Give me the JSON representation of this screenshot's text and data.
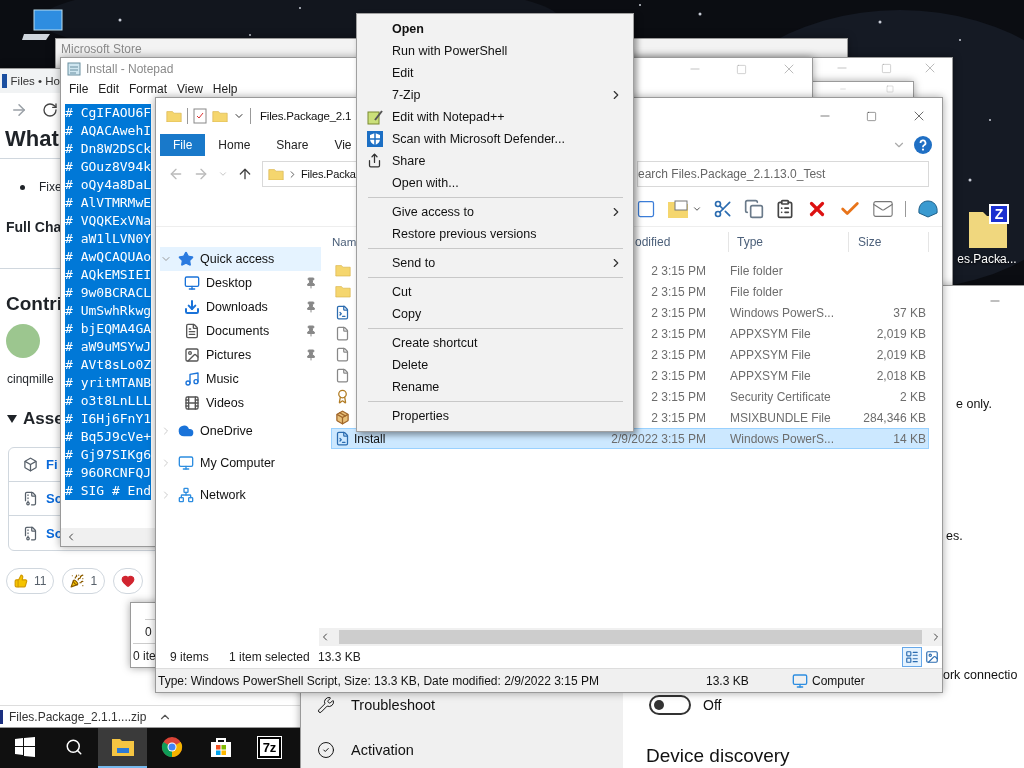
{
  "desktop": {
    "icons": [
      {
        "kind": "computer"
      },
      {
        "kind": "archive",
        "badge": "Z",
        "label": "es.Packa..."
      }
    ]
  },
  "store_window": {
    "title": "Microsoft Store"
  },
  "browser": {
    "tab": "Files • Ho",
    "heading": "What",
    "bullet": "Fixe",
    "subheading": "Full Cha",
    "contributors_heading": "Contri",
    "contributor": "cinqmille",
    "assets_heading": "Asse",
    "assets_expanded": true,
    "assets": [
      {
        "kind": "package",
        "label": "Fi"
      },
      {
        "kind": "zip",
        "label": "So"
      },
      {
        "kind": "zip",
        "label": "So"
      }
    ],
    "reactions": [
      {
        "kind": "thumbs-up",
        "count": "11"
      },
      {
        "kind": "party",
        "count": "1"
      },
      {
        "kind": "heart"
      }
    ],
    "download": {
      "file": "Files.Package_2.1.1....zip"
    }
  },
  "settings": {
    "items": [
      {
        "kind": "troubleshoot",
        "label": "Troubleshoot"
      },
      {
        "kind": "activation",
        "label": "Activation"
      }
    ],
    "fragments": [
      "e only.",
      "es.",
      "ork connectio"
    ],
    "toggle": {
      "on": false,
      "label": "Off"
    },
    "section": "Device discovery"
  },
  "small_window": {
    "lines": [
      "0",
      "0 ite"
    ]
  },
  "notepad": {
    "title": "Install - Notepad",
    "menu": [
      "File",
      "Edit",
      "Format",
      "View",
      "Help"
    ],
    "text_selected": true,
    "lines": [
      "# CgIFAOU6F",
      "# AQACAwehI",
      "# Dn8W2DSCk",
      "# GOuz8V94k",
      "# oQy4a8DaL",
      "# AlVTMRMwE",
      "# VQQKExVNa",
      "# aW1lLVN0Y",
      "# AwQCAQUAo",
      "# AQkEMSIEI",
      "# 9w0BCRACL",
      "# UmSwhRkwg",
      "# bjEQMA4GA",
      "# aW9uMSYwJ",
      "# AVt8sLo0Z",
      "# yritMTANB",
      "# o3t8LnLLL",
      "# I6Hj6FnY1",
      "# Bq5J9cVe+",
      "# Gj97SIKg6",
      "# 96ORCNFQJ",
      "# SIG # End"
    ]
  },
  "explorer": {
    "title": "Files.Package_2.1",
    "tabs": [
      {
        "label": "File",
        "selected": true
      },
      {
        "label": "Home",
        "selected": false
      },
      {
        "label": "Share",
        "selected": false
      },
      {
        "label": "Vie",
        "selected": false
      }
    ],
    "address": "Files.Packa",
    "search": {
      "placeholder": "earch Files.Package_2.1.13.0_Test"
    },
    "nav": [
      {
        "kind": "quick",
        "label": "Quick access",
        "selected": true,
        "expanded": true,
        "children": [
          {
            "kind": "desktop",
            "label": "Desktop",
            "pinned": true,
            "selected": false
          },
          {
            "kind": "downloads",
            "label": "Downloads",
            "pinned": true,
            "selected": false
          },
          {
            "kind": "documents",
            "label": "Documents",
            "pinned": true,
            "selected": false
          },
          {
            "kind": "pictures",
            "label": "Pictures",
            "pinned": true,
            "selected": false
          },
          {
            "kind": "music",
            "label": "Music",
            "pinned": false,
            "selected": false
          },
          {
            "kind": "videos",
            "label": "Videos",
            "pinned": false,
            "selected": false
          }
        ]
      },
      {
        "kind": "onedrive",
        "label": "OneDrive",
        "selected": false,
        "expanded": false
      },
      {
        "kind": "computer",
        "label": "My Computer",
        "selected": false,
        "expanded": false
      },
      {
        "kind": "network",
        "label": "Network",
        "selected": false,
        "expanded": false
      }
    ],
    "columns": [
      "Nam",
      "odified",
      "Type",
      "Size"
    ],
    "rows": [
      {
        "kind": "folder",
        "modified": "2 3:15 PM",
        "type": "File folder",
        "selected": false
      },
      {
        "kind": "folder",
        "modified": "2 3:15 PM",
        "type": "File folder",
        "selected": false
      },
      {
        "kind": "script",
        "modified": "2 3:15 PM",
        "type": "Windows PowerS...",
        "size": "37 KB",
        "selected": false
      },
      {
        "kind": "file",
        "modified": "2 3:15 PM",
        "type": "APPXSYM File",
        "size": "2,019 KB",
        "selected": false
      },
      {
        "kind": "file",
        "modified": "2 3:15 PM",
        "type": "APPXSYM File",
        "size": "2,019 KB",
        "selected": false
      },
      {
        "kind": "file",
        "modified": "2 3:15 PM",
        "type": "APPXSYM File",
        "size": "2,018 KB",
        "selected": false
      },
      {
        "kind": "certificate",
        "modified": "2 3:15 PM",
        "type": "Security Certificate",
        "size": "2 KB",
        "selected": false
      },
      {
        "kind": "package",
        "modified": "2 3:15 PM",
        "type": "MSIXBUNDLE File",
        "size": "284,346 KB",
        "selected": false
      },
      {
        "kind": "script",
        "name": "Install",
        "modified": "2/9/2022 3:15 PM",
        "type": "Windows PowerS...",
        "size": "14 KB",
        "selected": true
      }
    ],
    "status": {
      "count": "9 items",
      "selection": "1 item selected",
      "size": "13.3 KB"
    },
    "details": {
      "info": "Type: Windows PowerShell Script, Size: 13.3 KB, Date modified: 2/9/2022 3:15 PM",
      "size": "13.3 KB",
      "location": "Computer"
    }
  },
  "context_menu": {
    "items": [
      {
        "kind": "item",
        "label": "Open",
        "default": true,
        "submenu": false
      },
      {
        "kind": "item",
        "label": "Run with PowerShell",
        "default": false,
        "submenu": false
      },
      {
        "kind": "item",
        "label": "Edit",
        "default": false,
        "submenu": false
      },
      {
        "kind": "item",
        "label": "7-Zip",
        "default": false,
        "submenu": true
      },
      {
        "kind": "notepad",
        "label": "Edit with Notepad++",
        "default": false,
        "submenu": false
      },
      {
        "kind": "defender",
        "label": "Scan with Microsoft Defender...",
        "default": false,
        "submenu": false
      },
      {
        "kind": "share",
        "label": "Share",
        "default": false,
        "submenu": false
      },
      {
        "kind": "item",
        "label": "Open with...",
        "default": false,
        "submenu": false
      },
      {
        "kind": "separator"
      },
      {
        "kind": "item",
        "label": "Give access to",
        "default": false,
        "submenu": true
      },
      {
        "kind": "item",
        "label": "Restore previous versions",
        "default": false,
        "submenu": false
      },
      {
        "kind": "separator"
      },
      {
        "kind": "item",
        "label": "Send to",
        "default": false,
        "submenu": true
      },
      {
        "kind": "separator"
      },
      {
        "kind": "item",
        "label": "Cut",
        "default": false,
        "submenu": false
      },
      {
        "kind": "item",
        "label": "Copy",
        "default": false,
        "submenu": false
      },
      {
        "kind": "separator"
      },
      {
        "kind": "item",
        "label": "Create shortcut",
        "default": false,
        "submenu": false
      },
      {
        "kind": "item",
        "label": "Delete",
        "default": false,
        "submenu": false
      },
      {
        "kind": "item",
        "label": "Rename",
        "default": false,
        "submenu": false
      },
      {
        "kind": "separator"
      },
      {
        "kind": "item",
        "label": "Properties",
        "default": false,
        "submenu": false
      }
    ]
  },
  "taskbar": {
    "apps": [
      {
        "kind": "start",
        "active": false
      },
      {
        "kind": "search",
        "active": false
      },
      {
        "kind": "explorer",
        "active": true
      },
      {
        "kind": "chrome",
        "active": false
      },
      {
        "kind": "store",
        "active": false
      },
      {
        "kind": "sevenzip",
        "label": "7z",
        "active": false
      }
    ]
  }
}
